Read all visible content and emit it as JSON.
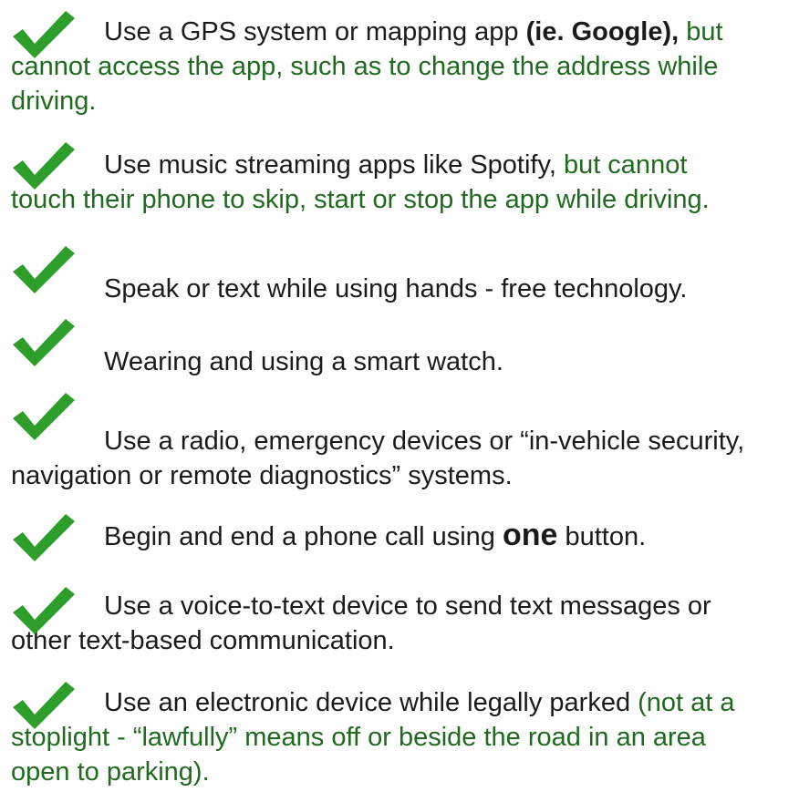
{
  "colors": {
    "check": "#2e9e2b",
    "text": "#1b1b1b",
    "note": "#1f6a1f"
  },
  "icon": "checkmark-icon",
  "items": [
    {
      "a": "Use a GPS system or mapping app ",
      "b": "(ie. Google),",
      "c": " but",
      "d": "cannot access the app, such as to change the address while",
      "e": "driving."
    },
    {
      "a": "Use music streaming apps like Spotify, ",
      "b": "but cannot",
      "c": "touch their phone to skip, start or stop the app while driving."
    },
    {
      "a": "Speak or text while using hands - free technology."
    },
    {
      "a": "Wearing and using a smart watch."
    },
    {
      "a": "Use a radio, emergency devices or “in-vehicle security,",
      "b": "navigation or remote diagnostics” systems."
    },
    {
      "a": "Begin and end a phone call using ",
      "b": "one",
      "c": " button."
    },
    {
      "a": "Use a voice-to-text device to send text messages or",
      "b": "other text-based communication."
    },
    {
      "a": "Use an electronic device while legally parked ",
      "b": "(not at a",
      "c": "stoplight - “lawfully” means off or beside the road in an area",
      "d": "open to parking)."
    }
  ]
}
